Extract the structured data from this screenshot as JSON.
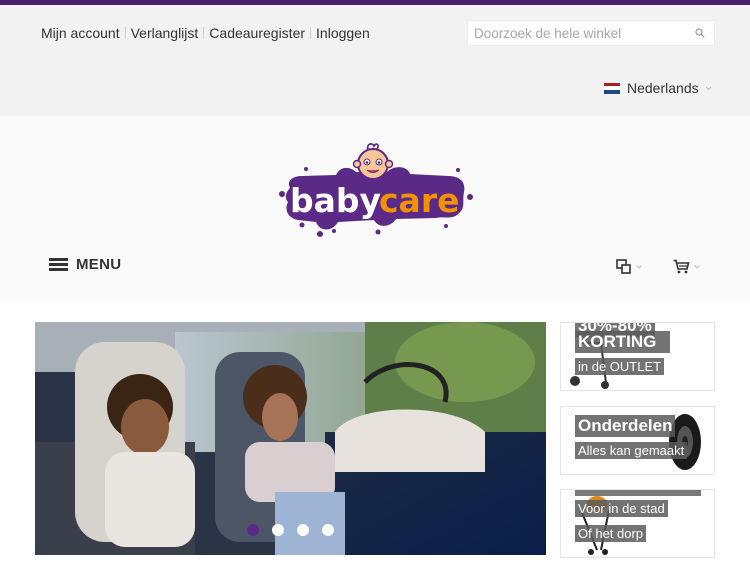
{
  "header": {
    "account_links": [
      "Mijn account",
      "Verlanglijst",
      "Cadeauregister",
      "Inloggen"
    ],
    "search_placeholder": "Doorzoek de hele winkel",
    "language": "Nederlands",
    "menu_label": "MENU"
  },
  "logo": {
    "text_purple": "baby",
    "text_orange": "care"
  },
  "slider": {
    "dot_count": 4,
    "active_dot": 0
  },
  "promos": [
    {
      "line1": "30%-80%",
      "line2": "KORTING",
      "line3": "in de OUTLET"
    },
    {
      "line1": "Onderdelen",
      "line2": "Alles kan gemaakt"
    },
    {
      "line1": "Voor in de stad",
      "line2": "Of het dorp"
    }
  ],
  "colors": {
    "brand_purple": "#5a2a86",
    "top_bar": "#4a1f6d",
    "logo_orange": "#f39200"
  }
}
